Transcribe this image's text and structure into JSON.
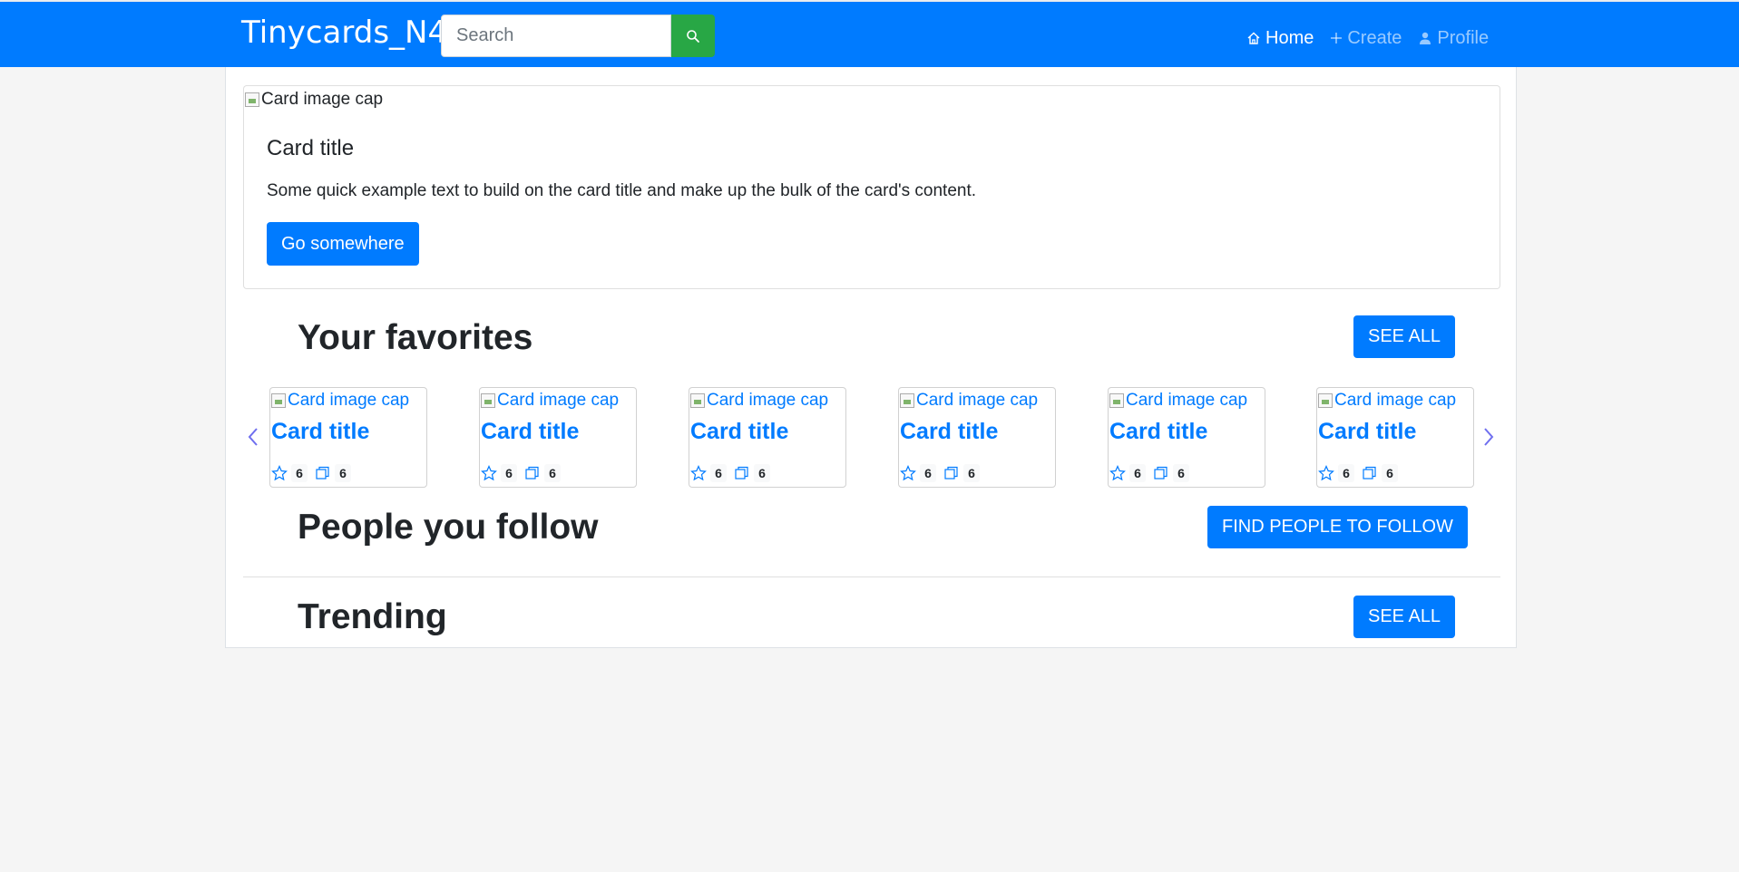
{
  "navbar": {
    "brand": "Tinycards_N4",
    "search_placeholder": "Search",
    "links": [
      {
        "label": "Home",
        "icon": "home-icon",
        "active": true
      },
      {
        "label": "Create",
        "icon": "plus-icon",
        "active": false
      },
      {
        "label": "Profile",
        "icon": "person-icon",
        "active": false
      }
    ]
  },
  "hero": {
    "image_alt": "Card image cap",
    "title": "Card title",
    "text": "Some quick example text to build on the card title and make up the bulk of the card's content.",
    "button": "Go somewhere"
  },
  "favorites": {
    "title": "Your favorites",
    "button": "SEE ALL",
    "cards": [
      {
        "image_alt": "Card image cap",
        "title": "Card title",
        "favorites": "6",
        "cards": "6"
      },
      {
        "image_alt": "Card image cap",
        "title": "Card title",
        "favorites": "6",
        "cards": "6"
      },
      {
        "image_alt": "Card image cap",
        "title": "Card title",
        "favorites": "6",
        "cards": "6"
      },
      {
        "image_alt": "Card image cap",
        "title": "Card title",
        "favorites": "6",
        "cards": "6"
      },
      {
        "image_alt": "Card image cap",
        "title": "Card title",
        "favorites": "6",
        "cards": "6"
      },
      {
        "image_alt": "Card image cap",
        "title": "Card title",
        "favorites": "6",
        "cards": "6"
      }
    ]
  },
  "people": {
    "title": "People you follow",
    "button": "FIND PEOPLE TO FOLLOW"
  },
  "trending": {
    "title": "Trending",
    "button": "SEE ALL"
  },
  "colors": {
    "primary": "#007bff",
    "success": "#28a745",
    "carousel_arrow": "#6f6fef"
  }
}
